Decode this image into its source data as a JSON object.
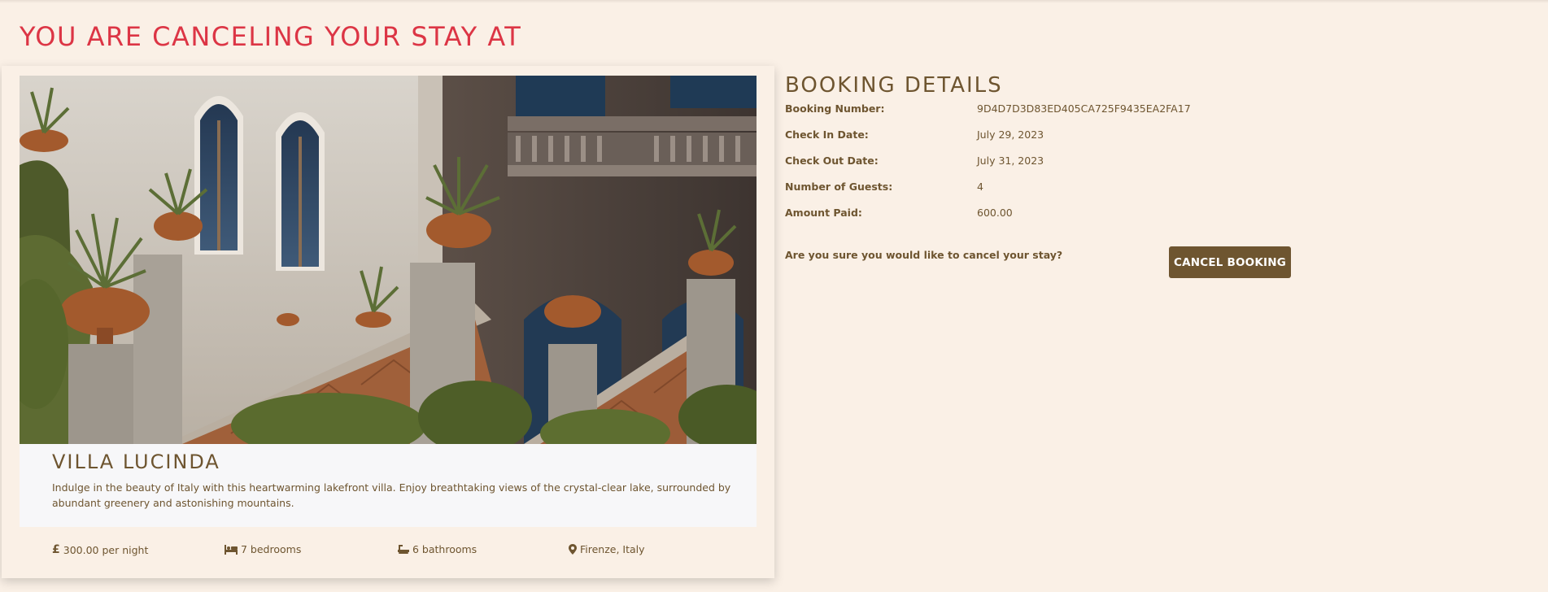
{
  "page": {
    "title": "YOU ARE CANCELING YOUR STAY AT"
  },
  "villa": {
    "image_alt": "Villa Lucinda exterior with stone staircase, potted palms and ivy",
    "name": "VILLA LUCINDA",
    "description": "Indulge in the beauty of Italy with this heartwarming lakefront villa. Enjoy breathtaking views of the crystal-clear lake, surrounded by abundant greenery and astonishing mountains.",
    "features": {
      "price": "300.00 per night",
      "bedrooms": "7 bedrooms",
      "bathrooms": "6 bathrooms",
      "location": "Firenze, Italy"
    }
  },
  "booking": {
    "title": "BOOKING DETAILS",
    "rows": [
      {
        "label": "Booking Number:",
        "value": "9D4D7D3D83ED405CA725F9435EA2FA17"
      },
      {
        "label": "Check In Date:",
        "value": "July 29, 2023"
      },
      {
        "label": "Check Out Date:",
        "value": "July 31, 2023"
      },
      {
        "label": "Number of Guests:",
        "value": "4"
      },
      {
        "label": "Amount Paid:",
        "value": "600.00"
      }
    ],
    "question": "Are you sure you would like to cancel your stay?",
    "cancel_label": "CANCEL BOOKING"
  },
  "colors": {
    "background": "#faf0e6",
    "title_red": "#dc3545",
    "brown": "#6e5530"
  },
  "icons": [
    "pound-icon",
    "bed-icon",
    "bath-icon",
    "map-marker-icon"
  ]
}
